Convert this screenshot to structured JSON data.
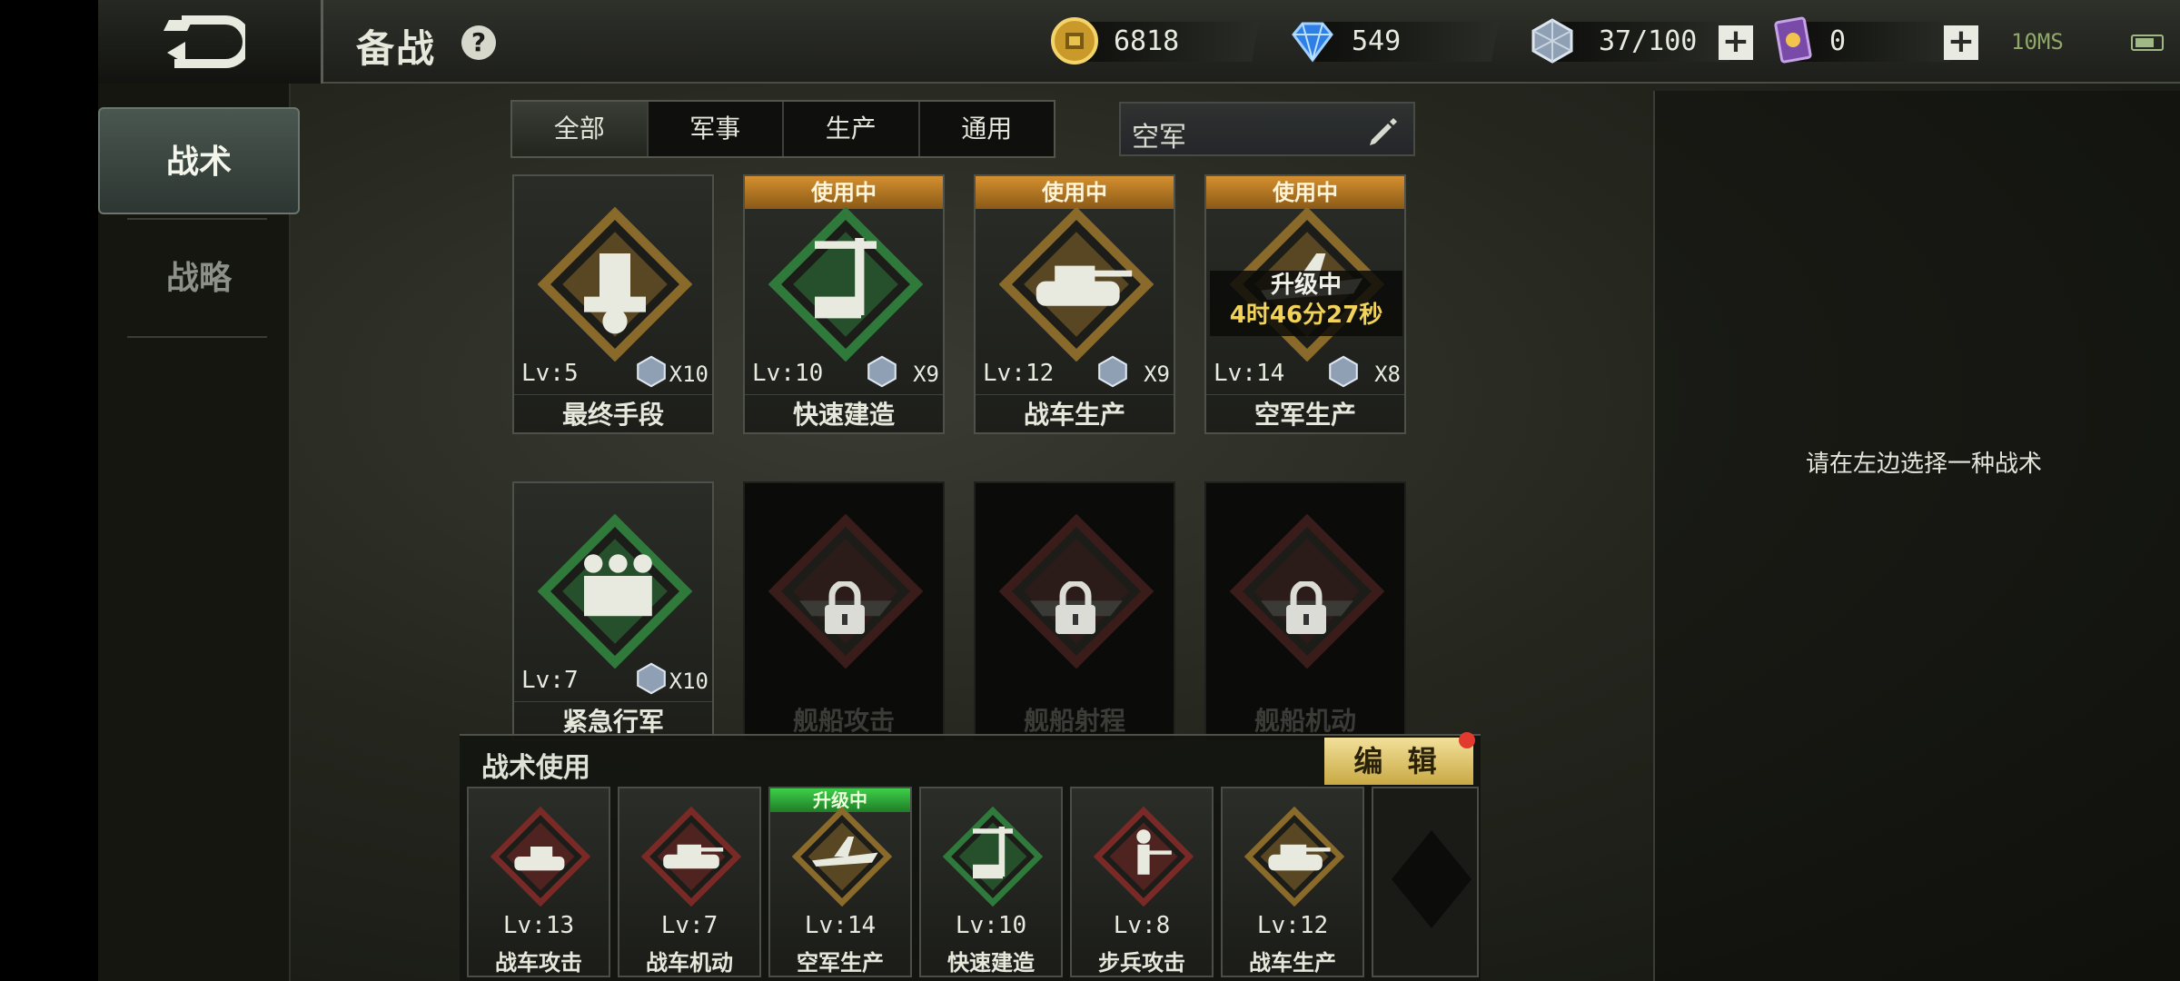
{
  "header": {
    "title": "备战",
    "help_label": "?",
    "gold": "6818",
    "diamonds": "549",
    "crystals": "37/100",
    "cards": "0",
    "ping": "10MS"
  },
  "nav": {
    "items": [
      {
        "label": "战术",
        "active": true
      },
      {
        "label": "战略",
        "active": false
      }
    ]
  },
  "filters": {
    "tabs": [
      "全部",
      "军事",
      "生产",
      "通用"
    ],
    "active_index": 0,
    "search_value": "空军"
  },
  "tactics": [
    {
      "name": "最终手段",
      "level": "Lv:5",
      "cost": "X10",
      "status": "",
      "icon": "final-measure-icon",
      "color": "#8a6a2a"
    },
    {
      "name": "快速建造",
      "level": "Lv:10",
      "cost": "X9",
      "status": "使用中",
      "icon": "crane-icon",
      "color": "#2f7a3a"
    },
    {
      "name": "战车生产",
      "level": "Lv:12",
      "cost": "X9",
      "status": "使用中",
      "icon": "tank-gear-icon",
      "color": "#8a6a2a"
    },
    {
      "name": "空军生产",
      "level": "Lv:14",
      "cost": "X8",
      "status": "使用中",
      "icon": "aircraft-gear-icon",
      "color": "#8a6a2a",
      "upgrade_label": "升级中",
      "upgrade_timer": "4时46分27秒"
    },
    {
      "name": "紧急行军",
      "level": "Lv:7",
      "cost": "X10",
      "status": "",
      "icon": "infantry-march-icon",
      "color": "#2f7a3a"
    },
    {
      "name": "舰船攻击",
      "level": "",
      "cost": "",
      "status": "",
      "icon": "ship-attack-icon",
      "locked": true
    },
    {
      "name": "舰船射程",
      "level": "",
      "cost": "",
      "status": "",
      "icon": "ship-range-icon",
      "locked": true
    },
    {
      "name": "舰船机动",
      "level": "",
      "cost": "",
      "status": "",
      "icon": "ship-mobility-icon",
      "locked": true
    }
  ],
  "right_panel": {
    "hint": "请在左边选择一种战术"
  },
  "loadout": {
    "title": "战术使用",
    "edit_label": "编 辑",
    "slots": [
      {
        "name": "战车攻击",
        "level": "Lv:13",
        "status": "",
        "icon": "tank-attack-icon",
        "color": "#7a2a26"
      },
      {
        "name": "战车机动",
        "level": "Lv:7",
        "status": "",
        "icon": "tank-mobility-icon",
        "color": "#7a2a26"
      },
      {
        "name": "空军生产",
        "level": "Lv:14",
        "status": "升级中",
        "icon": "aircraft-gear-icon",
        "color": "#8a6a2a"
      },
      {
        "name": "快速建造",
        "level": "Lv:10",
        "status": "",
        "icon": "crane-icon",
        "color": "#2f7a3a"
      },
      {
        "name": "步兵攻击",
        "level": "Lv:8",
        "status": "",
        "icon": "infantry-attack-icon",
        "color": "#7a2a26"
      },
      {
        "name": "战车生产",
        "level": "Lv:12",
        "status": "",
        "icon": "tank-gear-icon",
        "color": "#8a6a2a"
      },
      {
        "name": "",
        "level": "",
        "status": "",
        "icon": "empty-slot-icon",
        "empty": true
      }
    ]
  }
}
